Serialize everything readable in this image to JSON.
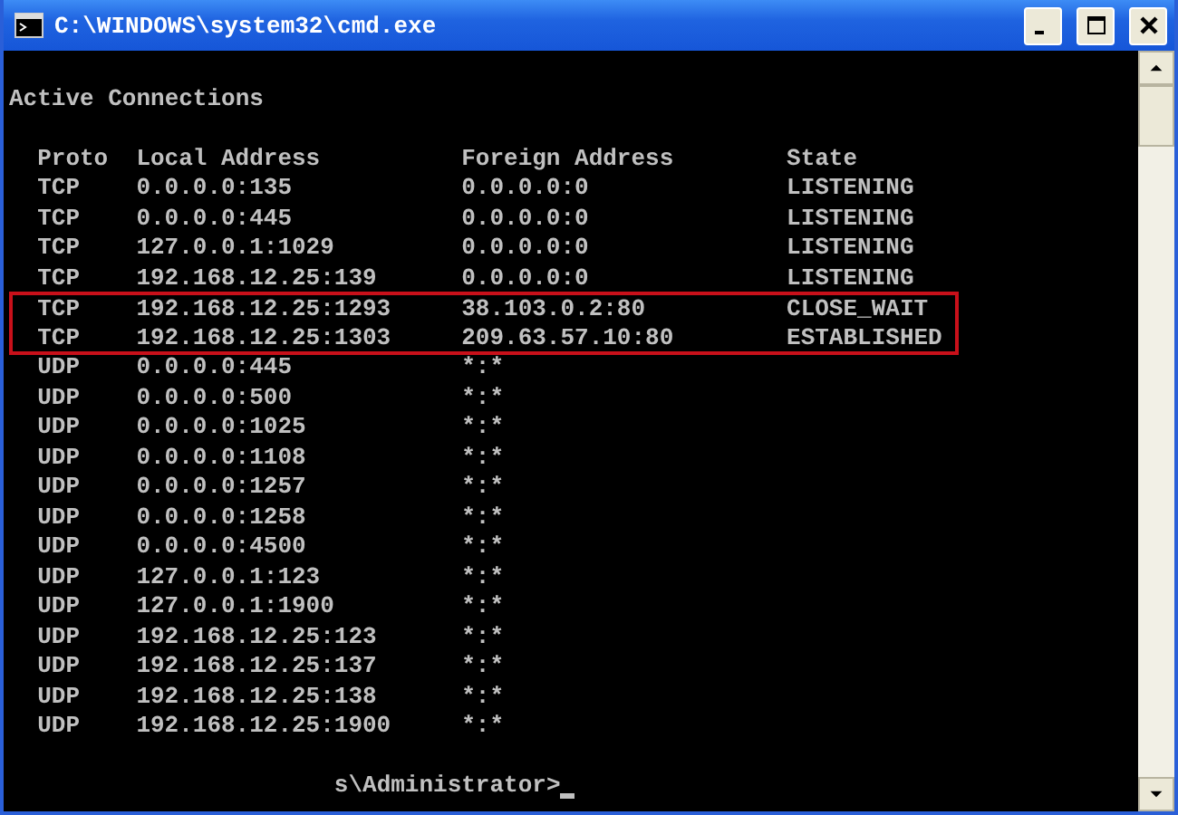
{
  "window": {
    "title": "C:\\WINDOWS\\system32\\cmd.exe"
  },
  "console": {
    "heading": "Active Connections",
    "columns": [
      "Proto",
      "Local Address",
      "Foreign Address",
      "State"
    ],
    "rows": [
      {
        "proto": "TCP",
        "local": "0.0.0.0:135",
        "foreign": "0.0.0.0:0",
        "state": "LISTENING",
        "highlighted": false
      },
      {
        "proto": "TCP",
        "local": "0.0.0.0:445",
        "foreign": "0.0.0.0:0",
        "state": "LISTENING",
        "highlighted": false
      },
      {
        "proto": "TCP",
        "local": "127.0.0.1:1029",
        "foreign": "0.0.0.0:0",
        "state": "LISTENING",
        "highlighted": false
      },
      {
        "proto": "TCP",
        "local": "192.168.12.25:139",
        "foreign": "0.0.0.0:0",
        "state": "LISTENING",
        "highlighted": false
      },
      {
        "proto": "TCP",
        "local": "192.168.12.25:1293",
        "foreign": "38.103.0.2:80",
        "state": "CLOSE_WAIT",
        "highlighted": true
      },
      {
        "proto": "TCP",
        "local": "192.168.12.25:1303",
        "foreign": "209.63.57.10:80",
        "state": "ESTABLISHED",
        "highlighted": true
      },
      {
        "proto": "UDP",
        "local": "0.0.0.0:445",
        "foreign": "*:*",
        "state": "",
        "highlighted": false
      },
      {
        "proto": "UDP",
        "local": "0.0.0.0:500",
        "foreign": "*:*",
        "state": "",
        "highlighted": false
      },
      {
        "proto": "UDP",
        "local": "0.0.0.0:1025",
        "foreign": "*:*",
        "state": "",
        "highlighted": false
      },
      {
        "proto": "UDP",
        "local": "0.0.0.0:1108",
        "foreign": "*:*",
        "state": "",
        "highlighted": false
      },
      {
        "proto": "UDP",
        "local": "0.0.0.0:1257",
        "foreign": "*:*",
        "state": "",
        "highlighted": false
      },
      {
        "proto": "UDP",
        "local": "0.0.0.0:1258",
        "foreign": "*:*",
        "state": "",
        "highlighted": false
      },
      {
        "proto": "UDP",
        "local": "0.0.0.0:4500",
        "foreign": "*:*",
        "state": "",
        "highlighted": false
      },
      {
        "proto": "UDP",
        "local": "127.0.0.1:123",
        "foreign": "*:*",
        "state": "",
        "highlighted": false
      },
      {
        "proto": "UDP",
        "local": "127.0.0.1:1900",
        "foreign": "*:*",
        "state": "",
        "highlighted": false
      },
      {
        "proto": "UDP",
        "local": "192.168.12.25:123",
        "foreign": "*:*",
        "state": "",
        "highlighted": false
      },
      {
        "proto": "UDP",
        "local": "192.168.12.25:137",
        "foreign": "*:*",
        "state": "",
        "highlighted": false
      },
      {
        "proto": "UDP",
        "local": "192.168.12.25:138",
        "foreign": "*:*",
        "state": "",
        "highlighted": false
      },
      {
        "proto": "UDP",
        "local": "192.168.12.25:1900",
        "foreign": "*:*",
        "state": "",
        "highlighted": false
      }
    ],
    "prompt": "s\\Administrator>"
  }
}
